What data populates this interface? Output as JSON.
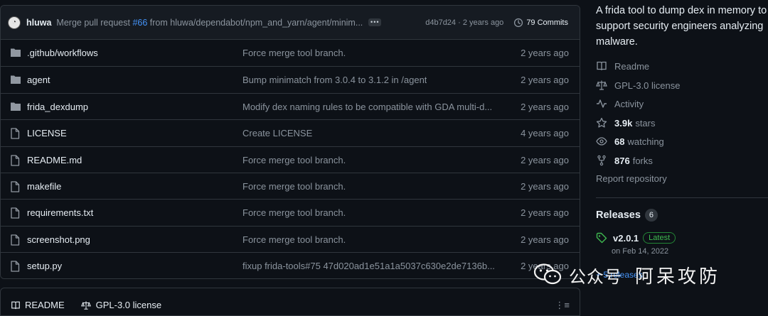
{
  "commit_bar": {
    "author": "hluwa",
    "message_prefix": "Merge pull request",
    "pr_link": "#66",
    "message_suffix": "from hluwa/dependabot/npm_and_yarn/agent/minim...",
    "ellipsis": "•••",
    "sha_time": "d4b7d24 · 2 years ago",
    "commits": "79 Commits"
  },
  "files": [
    {
      "icon": "folder-icon",
      "name": ".github/workflows",
      "message": "Force merge tool branch.",
      "age": "2 years ago"
    },
    {
      "icon": "folder-icon",
      "name": "agent",
      "message": "Bump minimatch from 3.0.4 to 3.1.2 in /agent",
      "age": "2 years ago"
    },
    {
      "icon": "folder-icon",
      "name": "frida_dexdump",
      "message": "Modify dex naming rules to be compatible with GDA multi-d...",
      "age": "2 years ago"
    },
    {
      "icon": "file-icon",
      "name": "LICENSE",
      "message": "Create LICENSE",
      "age": "4 years ago"
    },
    {
      "icon": "file-icon",
      "name": "README.md",
      "message": "Force merge tool branch.",
      "age": "2 years ago"
    },
    {
      "icon": "file-icon",
      "name": "makefile",
      "message": "Force merge tool branch.",
      "age": "2 years ago"
    },
    {
      "icon": "file-icon",
      "name": "requirements.txt",
      "message": "Force merge tool branch.",
      "age": "2 years ago"
    },
    {
      "icon": "file-icon",
      "name": "screenshot.png",
      "message": "Force merge tool branch.",
      "age": "2 years ago"
    },
    {
      "icon": "file-icon",
      "name": "setup.py",
      "message": "fixup frida-tools#75 47d020ad1e51a1a5037c630e2de7136b...",
      "age": "2 years ago"
    }
  ],
  "readme_bar": {
    "tab_readme": "README",
    "tab_license": "GPL-3.0 license",
    "kebab": "⋮≡"
  },
  "sidebar": {
    "about": "A frida tool to dump dex in memory to support security engineers analyzing malware.",
    "readme": "Readme",
    "license": "GPL-3.0 license",
    "activity": "Activity",
    "stars_count": "3.9k",
    "stars_label": "stars",
    "watching_count": "68",
    "watching_label": "watching",
    "forks_count": "876",
    "forks_label": "forks",
    "report": "Report repository",
    "releases_title": "Releases",
    "releases_count": "6",
    "release_version": "v2.0.1",
    "release_badge": "Latest",
    "release_date": "on Feb 14, 2022",
    "more_releases": "+ 5 releases"
  },
  "watermark": {
    "text_a": "公众号",
    "text_b": "阿呆攻防"
  },
  "colors": {
    "background": "#0d1117",
    "border": "#30363d",
    "muted": "#8b949e",
    "link": "#4493f8",
    "success": "#3fb950"
  }
}
